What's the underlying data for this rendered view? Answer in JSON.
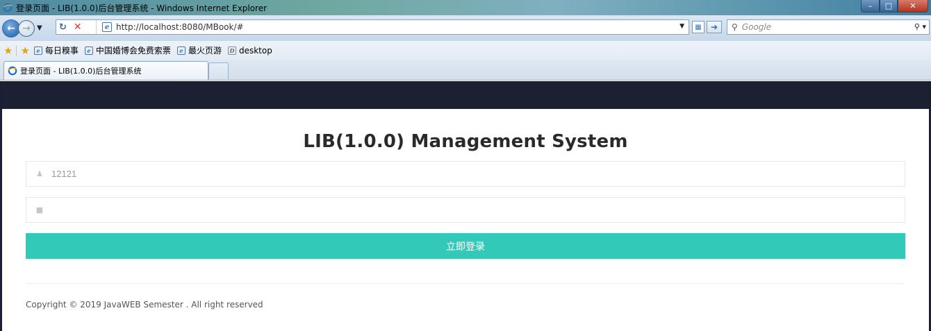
{
  "window": {
    "title": "登录页面 - LIB(1.0.0)后台管理系统 - Windows Internet Explorer",
    "minimize_glyph": "–",
    "maximize_glyph": "□",
    "close_glyph": "✕"
  },
  "toolbar": {
    "url": "http://localhost:8080/MBook/#",
    "search_placeholder": "Google"
  },
  "favorites": [
    {
      "label": "每日糗事"
    },
    {
      "label": "中国婚博会免费索票"
    },
    {
      "label": "最火页游"
    },
    {
      "label": "desktop"
    }
  ],
  "tab": {
    "label": "登录页面 - LIB(1.0.0)后台管理系统"
  },
  "page": {
    "heading": "LIB(1.0.0) Management System",
    "username_value": "12121",
    "password_value": "",
    "login_button_label": "立即登录",
    "copyright": "Copyright © 2019 JavaWEB Semester . All right reserved",
    "colors": {
      "accent": "#33c9b8",
      "topbar": "#1c2033"
    }
  },
  "icons": {
    "user_field": "user-icon",
    "password_field": "lock-icon"
  }
}
